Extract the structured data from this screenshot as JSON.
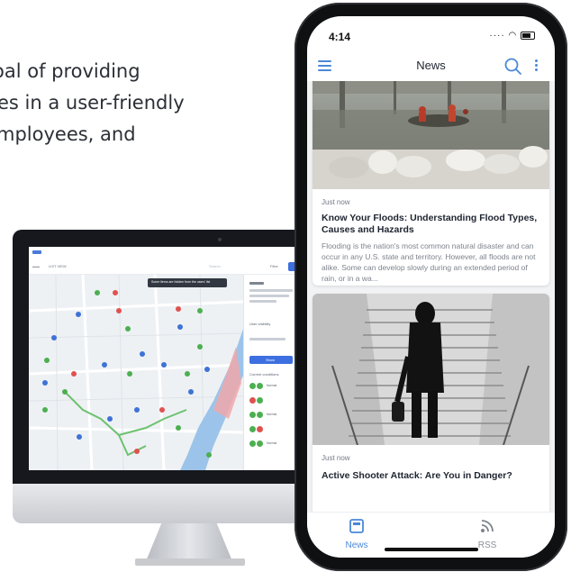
{
  "intro": {
    "line1": "oal of providing",
    "line2": "es in a user-friendly",
    "line3": "mployees, and"
  },
  "desktop": {
    "toolbar_tab": "LIST VIEW",
    "search_placeholder": "Search",
    "filter_label": "Filter",
    "tooltip": "Some items are hidden from the users' list",
    "panel_user_visibility": "User visibility",
    "panel_current_conditions": "Current conditions",
    "panel_button": "Show",
    "condition_label": "Normal"
  },
  "phone": {
    "status": {
      "time": "4:14"
    },
    "appbar": {
      "title": "News"
    },
    "articles": [
      {
        "meta": "Just now",
        "title": "Know Your Floods: Understanding Flood Types, Causes and Hazards",
        "excerpt": "Flooding is the nation's most common natural disaster and can occur in any U.S. state and territory. However, all floods are not alike. Some can develop slowly during an extended period of rain, or in a wa..."
      },
      {
        "meta": "Just now",
        "title": "Active Shooter Attack: Are You in Danger?"
      }
    ],
    "tabs": [
      {
        "label": "News",
        "active": true
      },
      {
        "label": "RSS",
        "active": false
      }
    ]
  },
  "colors": {
    "accent": "#4a88d6",
    "tab_active": "#4a88d6",
    "tab_inactive": "#8a9099",
    "map_marker_red": "#e0524f",
    "map_marker_green": "#4caf50",
    "map_marker_blue": "#3e73d6"
  }
}
